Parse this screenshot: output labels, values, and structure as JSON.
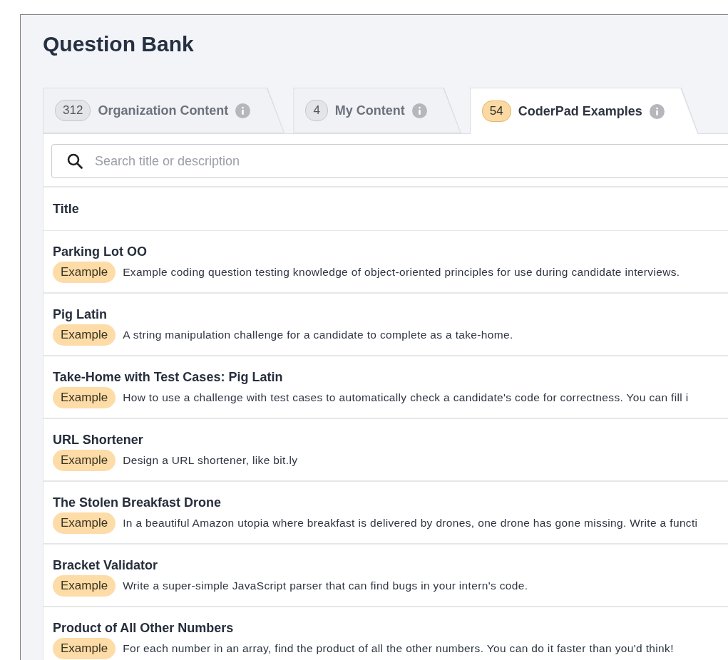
{
  "title": "Question Bank",
  "tabs": [
    {
      "count": "312",
      "label": "Organization Content",
      "selected": false
    },
    {
      "count": "4",
      "label": "My Content",
      "selected": false
    },
    {
      "count": "54",
      "label": "CoderPad Examples",
      "selected": true
    }
  ],
  "search": {
    "placeholder": "Search title or description"
  },
  "table": {
    "columns": [
      "Title"
    ],
    "rows": [
      {
        "title": "Parking Lot OO",
        "tag": "Example",
        "description": "Example coding question testing knowledge of object-oriented principles for use during candidate interviews."
      },
      {
        "title": "Pig Latin",
        "tag": "Example",
        "description": "A string manipulation challenge for a candidate to complete as a take-home."
      },
      {
        "title": "Take-Home with Test Cases: Pig Latin",
        "tag": "Example",
        "description": "How to use a challenge with test cases to automatically check a candidate's code for correctness. You can fill i"
      },
      {
        "title": "URL Shortener",
        "tag": "Example",
        "description": "Design a URL shortener, like bit.ly"
      },
      {
        "title": "The Stolen Breakfast Drone",
        "tag": "Example",
        "description": "In a beautiful Amazon utopia where breakfast is delivered by drones, one drone has gone missing. Write a functi"
      },
      {
        "title": "Bracket Validator",
        "tag": "Example",
        "description": "Write a super-simple JavaScript parser that can find bugs in your intern's code."
      },
      {
        "title": "Product of All Other Numbers",
        "tag": "Example",
        "description": "For each number in an array, find the product of all the other numbers. You can do it faster than you'd think!"
      }
    ]
  }
}
